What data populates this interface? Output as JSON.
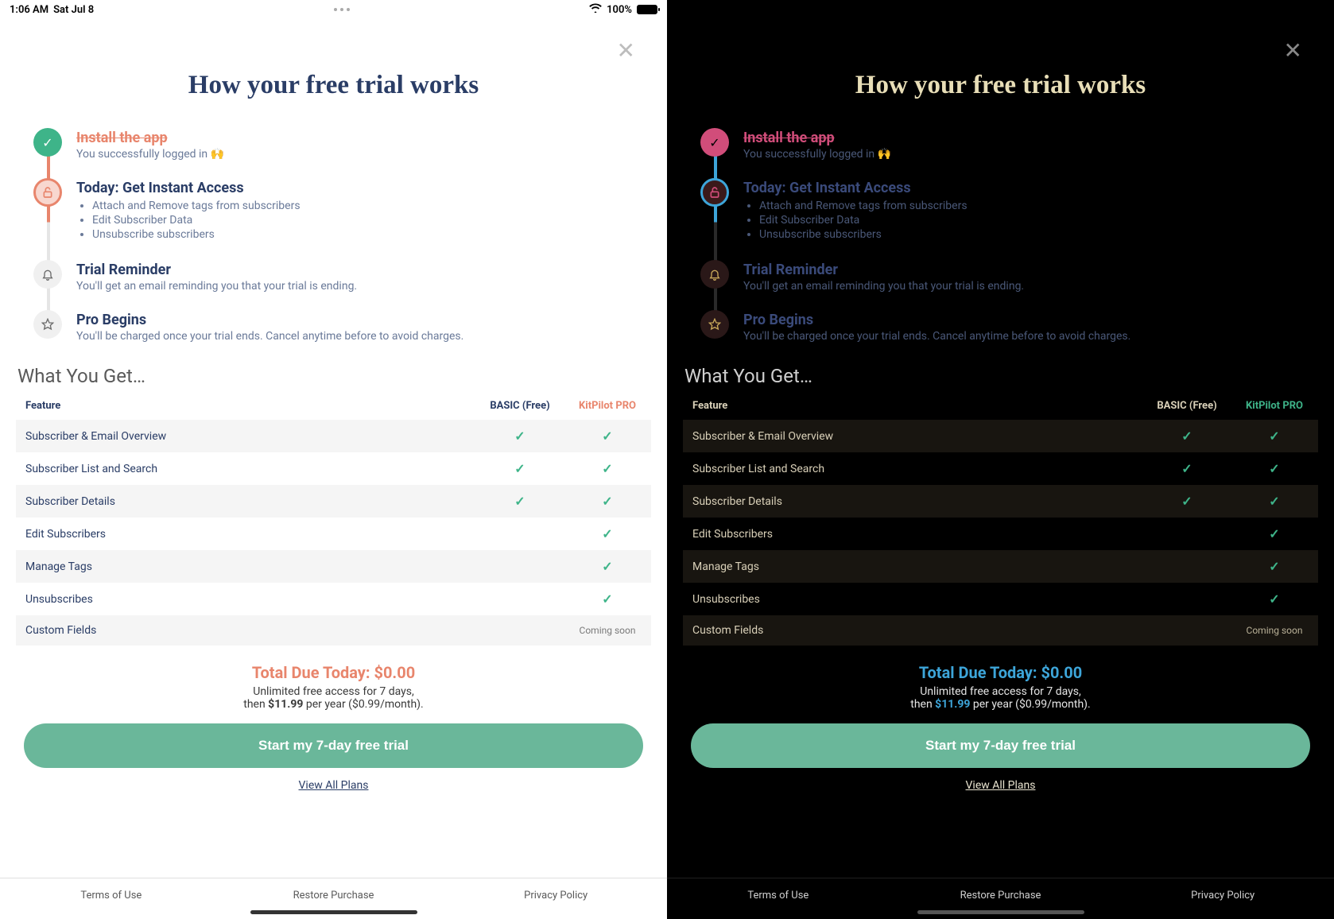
{
  "status": {
    "time": "1:06 AM",
    "date": "Sat Jul 8",
    "battery": "100%"
  },
  "close_glyph": "✕",
  "title": "How your free trial works",
  "steps": {
    "install": {
      "icon_glyph": "✓",
      "title": "Install the app",
      "sub": "You successfully logged in 🙌"
    },
    "today": {
      "icon_glyph": "🔓",
      "title": "Today: Get Instant Access",
      "items": [
        "Attach and Remove tags from subscribers",
        "Edit Subscriber Data",
        "Unsubscribe subscribers"
      ]
    },
    "reminder": {
      "icon_glyph": "🔔",
      "title": "Trial Reminder",
      "sub": "You'll get an email reminding you that your trial is ending."
    },
    "pro": {
      "icon_glyph": "☆",
      "title": "Pro Begins",
      "sub": "You'll be charged once your trial ends. Cancel anytime before to avoid charges."
    }
  },
  "wyg_heading": "What You Get…",
  "table": {
    "headers": {
      "feature": "Feature",
      "basic": "BASIC (Free)",
      "pro": "KitPilot PRO"
    },
    "rows": [
      {
        "name": "Subscriber & Email Overview",
        "basic": "✓",
        "pro": "✓"
      },
      {
        "name": "Subscriber List and Search",
        "basic": "✓",
        "pro": "✓"
      },
      {
        "name": "Subscriber Details",
        "basic": "✓",
        "pro": "✓"
      },
      {
        "name": "Edit Subscribers",
        "basic": "",
        "pro": "✓"
      },
      {
        "name": "Manage Tags",
        "basic": "",
        "pro": "✓"
      },
      {
        "name": "Unsubscribes",
        "basic": "",
        "pro": "✓"
      },
      {
        "name": "Custom Fields",
        "basic": "",
        "pro": "Coming soon",
        "soon": true
      }
    ]
  },
  "pricing": {
    "due": "Total Due Today: $0.00",
    "line1": "Unlimited free access for 7 days,",
    "line2_pre": "then ",
    "price": "$11.99",
    "line2_post": " per year ($0.99/month)."
  },
  "cta": "Start my 7-day free trial",
  "view_all": "View All Plans",
  "footer": {
    "terms": "Terms of Use",
    "restore": "Restore Purchase",
    "privacy": "Privacy Policy"
  }
}
